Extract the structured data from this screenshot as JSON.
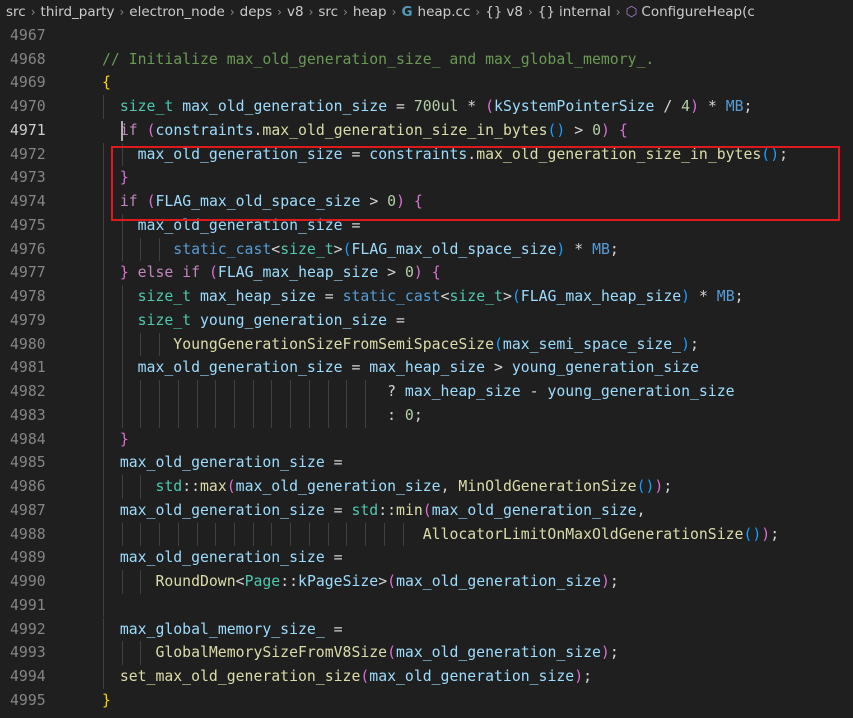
{
  "breadcrumb": [
    {
      "label": "src",
      "kind": "folder"
    },
    {
      "label": "third_party",
      "kind": "folder"
    },
    {
      "label": "electron_node",
      "kind": "folder"
    },
    {
      "label": "deps",
      "kind": "folder"
    },
    {
      "label": "v8",
      "kind": "folder"
    },
    {
      "label": "src",
      "kind": "folder"
    },
    {
      "label": "heap",
      "kind": "folder"
    },
    {
      "label": "heap.cc",
      "kind": "cpp-file-icon"
    },
    {
      "label": "v8",
      "kind": "namespace-icon"
    },
    {
      "label": "internal",
      "kind": "namespace-icon"
    },
    {
      "label": "ConfigureHeap(c",
      "kind": "method-icon"
    }
  ],
  "editor": {
    "active_line": 4971,
    "lines": [
      {
        "n": "4967",
        "guides": [],
        "tokens": []
      },
      {
        "n": "4968",
        "guides": [],
        "tokens": [
          [
            "cm",
            "// Initialize max_old_generation_size_ and max_global_memory_."
          ]
        ]
      },
      {
        "n": "4969",
        "guides": [],
        "tokens": [
          [
            "br1",
            "{"
          ]
        ]
      },
      {
        "n": "4970",
        "guides": [
          1
        ],
        "tokens": [
          [
            "pl",
            "  "
          ],
          [
            "type",
            "size_t"
          ],
          [
            "pl",
            " "
          ],
          [
            "var",
            "max_old_generation_size"
          ],
          [
            "pl",
            " = "
          ],
          [
            "num",
            "700ul"
          ],
          [
            "pl",
            " * "
          ],
          [
            "br2",
            "("
          ],
          [
            "var",
            "kSystemPointerSize"
          ],
          [
            "pl",
            " / "
          ],
          [
            "num",
            "4"
          ],
          [
            "br2",
            ")"
          ],
          [
            "pl",
            " * "
          ],
          [
            "mac",
            "MB"
          ],
          [
            "pl",
            ";"
          ]
        ]
      },
      {
        "n": "4971",
        "guides": [],
        "tokens": [
          [
            "pl",
            "  "
          ],
          [
            "ctl",
            "if"
          ],
          [
            "pl",
            " "
          ],
          [
            "br2",
            "("
          ],
          [
            "var",
            "constraints"
          ],
          [
            "pl",
            "."
          ],
          [
            "fn",
            "max_old_generation_size_in_bytes"
          ],
          [
            "br3",
            "()"
          ],
          [
            "pl",
            " > "
          ],
          [
            "num",
            "0"
          ],
          [
            "br2",
            ")"
          ],
          [
            "pl",
            " "
          ],
          [
            "br2",
            "{"
          ]
        ]
      },
      {
        "n": "4972",
        "guides": [
          1,
          2
        ],
        "tokens": [
          [
            "pl",
            "    "
          ],
          [
            "var",
            "max_old_generation_size"
          ],
          [
            "pl",
            " = "
          ],
          [
            "var",
            "constraints"
          ],
          [
            "pl",
            "."
          ],
          [
            "fn",
            "max_old_generation_size_in_bytes"
          ],
          [
            "br3",
            "()"
          ],
          [
            "pl",
            ";"
          ]
        ]
      },
      {
        "n": "4973",
        "guides": [
          1
        ],
        "tokens": [
          [
            "pl",
            "  "
          ],
          [
            "br2",
            "}"
          ]
        ]
      },
      {
        "n": "4974",
        "guides": [
          1
        ],
        "tokens": [
          [
            "pl",
            "  "
          ],
          [
            "ctl",
            "if"
          ],
          [
            "pl",
            " "
          ],
          [
            "br2",
            "("
          ],
          [
            "var",
            "FLAG_max_old_space_size"
          ],
          [
            "pl",
            " > "
          ],
          [
            "num",
            "0"
          ],
          [
            "br2",
            ")"
          ],
          [
            "pl",
            " "
          ],
          [
            "br2",
            "{"
          ]
        ]
      },
      {
        "n": "4975",
        "guides": [
          1,
          2
        ],
        "tokens": [
          [
            "pl",
            "    "
          ],
          [
            "var",
            "max_old_generation_size"
          ],
          [
            "pl",
            " ="
          ]
        ]
      },
      {
        "n": "4976",
        "guides": [
          1,
          2,
          3,
          4
        ],
        "tokens": [
          [
            "pl",
            "        "
          ],
          [
            "kw",
            "static_cast"
          ],
          [
            "pl",
            "<"
          ],
          [
            "type",
            "size_t"
          ],
          [
            "pl",
            ">"
          ],
          [
            "br3",
            "("
          ],
          [
            "var",
            "FLAG_max_old_space_size"
          ],
          [
            "br3",
            ")"
          ],
          [
            "pl",
            " * "
          ],
          [
            "mac",
            "MB"
          ],
          [
            "pl",
            ";"
          ]
        ]
      },
      {
        "n": "4977",
        "guides": [
          1
        ],
        "tokens": [
          [
            "pl",
            "  "
          ],
          [
            "br2",
            "}"
          ],
          [
            "pl",
            " "
          ],
          [
            "ctl",
            "else"
          ],
          [
            "pl",
            " "
          ],
          [
            "ctl",
            "if"
          ],
          [
            "pl",
            " "
          ],
          [
            "br2",
            "("
          ],
          [
            "var",
            "FLAG_max_heap_size"
          ],
          [
            "pl",
            " > "
          ],
          [
            "num",
            "0"
          ],
          [
            "br2",
            ")"
          ],
          [
            "pl",
            " "
          ],
          [
            "br2",
            "{"
          ]
        ]
      },
      {
        "n": "4978",
        "guides": [
          1,
          2
        ],
        "tokens": [
          [
            "pl",
            "    "
          ],
          [
            "type",
            "size_t"
          ],
          [
            "pl",
            " "
          ],
          [
            "var",
            "max_heap_size"
          ],
          [
            "pl",
            " = "
          ],
          [
            "kw",
            "static_cast"
          ],
          [
            "pl",
            "<"
          ],
          [
            "type",
            "size_t"
          ],
          [
            "pl",
            ">"
          ],
          [
            "br3",
            "("
          ],
          [
            "var",
            "FLAG_max_heap_size"
          ],
          [
            "br3",
            ")"
          ],
          [
            "pl",
            " * "
          ],
          [
            "mac",
            "MB"
          ],
          [
            "pl",
            ";"
          ]
        ]
      },
      {
        "n": "4979",
        "guides": [
          1,
          2
        ],
        "tokens": [
          [
            "pl",
            "    "
          ],
          [
            "type",
            "size_t"
          ],
          [
            "pl",
            " "
          ],
          [
            "var",
            "young_generation_size"
          ],
          [
            "pl",
            " ="
          ]
        ]
      },
      {
        "n": "4980",
        "guides": [
          1,
          2,
          3,
          4
        ],
        "tokens": [
          [
            "pl",
            "        "
          ],
          [
            "fn",
            "YoungGenerationSizeFromSemiSpaceSize"
          ],
          [
            "br3",
            "("
          ],
          [
            "var",
            "max_semi_space_size_"
          ],
          [
            "br3",
            ")"
          ],
          [
            "pl",
            ";"
          ]
        ]
      },
      {
        "n": "4981",
        "guides": [
          1,
          2
        ],
        "tokens": [
          [
            "pl",
            "    "
          ],
          [
            "var",
            "max_old_generation_size"
          ],
          [
            "pl",
            " = "
          ],
          [
            "var",
            "max_heap_size"
          ],
          [
            "pl",
            " > "
          ],
          [
            "var",
            "young_generation_size"
          ]
        ]
      },
      {
        "n": "4982",
        "guides": [
          1,
          2,
          3,
          4,
          5,
          6,
          7,
          8,
          9,
          10,
          11,
          12,
          13,
          14,
          15
        ],
        "tokens": [
          [
            "pl",
            "                                "
          ],
          [
            "pl",
            "? "
          ],
          [
            "var",
            "max_heap_size"
          ],
          [
            "pl",
            " - "
          ],
          [
            "var",
            "young_generation_size"
          ]
        ]
      },
      {
        "n": "4983",
        "guides": [
          1,
          2,
          3,
          4,
          5,
          6,
          7,
          8,
          9,
          10,
          11,
          12,
          13,
          14,
          15
        ],
        "tokens": [
          [
            "pl",
            "                                "
          ],
          [
            "pl",
            ": "
          ],
          [
            "num",
            "0"
          ],
          [
            "pl",
            ";"
          ]
        ]
      },
      {
        "n": "4984",
        "guides": [
          1
        ],
        "tokens": [
          [
            "pl",
            "  "
          ],
          [
            "br2",
            "}"
          ]
        ]
      },
      {
        "n": "4985",
        "guides": [
          1
        ],
        "tokens": [
          [
            "pl",
            "  "
          ],
          [
            "var",
            "max_old_generation_size"
          ],
          [
            "pl",
            " ="
          ]
        ]
      },
      {
        "n": "4986",
        "guides": [
          1,
          2,
          3
        ],
        "tokens": [
          [
            "pl",
            "      "
          ],
          [
            "type",
            "std"
          ],
          [
            "pl",
            "::"
          ],
          [
            "fn",
            "max"
          ],
          [
            "br2",
            "("
          ],
          [
            "var",
            "max_old_generation_size"
          ],
          [
            "pl",
            ", "
          ],
          [
            "fn",
            "MinOldGenerationSize"
          ],
          [
            "br3",
            "()"
          ],
          [
            "br2",
            ")"
          ],
          [
            "pl",
            ";"
          ]
        ]
      },
      {
        "n": "4987",
        "guides": [
          1
        ],
        "tokens": [
          [
            "pl",
            "  "
          ],
          [
            "var",
            "max_old_generation_size"
          ],
          [
            "pl",
            " = "
          ],
          [
            "type",
            "std"
          ],
          [
            "pl",
            "::"
          ],
          [
            "fn",
            "min"
          ],
          [
            "br2",
            "("
          ],
          [
            "var",
            "max_old_generation_size"
          ],
          [
            "pl",
            ","
          ]
        ]
      },
      {
        "n": "4988",
        "guides": [
          1,
          2,
          3,
          4,
          5,
          6,
          7,
          8,
          9,
          10,
          11,
          12,
          13,
          14,
          15,
          16,
          17
        ],
        "tokens": [
          [
            "pl",
            "                                    "
          ],
          [
            "fn",
            "AllocatorLimitOnMaxOldGenerationSize"
          ],
          [
            "br3",
            "()"
          ],
          [
            "br2",
            ")"
          ],
          [
            "pl",
            ";"
          ]
        ]
      },
      {
        "n": "4989",
        "guides": [
          1
        ],
        "tokens": [
          [
            "pl",
            "  "
          ],
          [
            "var",
            "max_old_generation_size"
          ],
          [
            "pl",
            " ="
          ]
        ]
      },
      {
        "n": "4990",
        "guides": [
          1,
          2,
          3
        ],
        "tokens": [
          [
            "pl",
            "      "
          ],
          [
            "fn",
            "RoundDown"
          ],
          [
            "pl",
            "<"
          ],
          [
            "type",
            "Page"
          ],
          [
            "pl",
            "::"
          ],
          [
            "var",
            "kPageSize"
          ],
          [
            "pl",
            ">"
          ],
          [
            "br2",
            "("
          ],
          [
            "var",
            "max_old_generation_size"
          ],
          [
            "br2",
            ")"
          ],
          [
            "pl",
            ";"
          ]
        ]
      },
      {
        "n": "4991",
        "guides": [
          1
        ],
        "tokens": []
      },
      {
        "n": "4992",
        "guides": [
          1
        ],
        "tokens": [
          [
            "pl",
            "  "
          ],
          [
            "var",
            "max_global_memory_size_"
          ],
          [
            "pl",
            " ="
          ]
        ]
      },
      {
        "n": "4993",
        "guides": [
          1,
          2,
          3
        ],
        "tokens": [
          [
            "pl",
            "      "
          ],
          [
            "fn",
            "GlobalMemorySizeFromV8Size"
          ],
          [
            "br2",
            "("
          ],
          [
            "var",
            "max_old_generation_size"
          ],
          [
            "br2",
            ")"
          ],
          [
            "pl",
            ";"
          ]
        ]
      },
      {
        "n": "4994",
        "guides": [
          1
        ],
        "tokens": [
          [
            "pl",
            "  "
          ],
          [
            "fn",
            "set_max_old_generation_size"
          ],
          [
            "br2",
            "("
          ],
          [
            "var",
            "max_old_generation_size"
          ],
          [
            "br2",
            ")"
          ],
          [
            "pl",
            ";"
          ]
        ]
      },
      {
        "n": "4995",
        "guides": [],
        "tokens": [
          [
            "br1",
            "}"
          ]
        ]
      }
    ]
  },
  "colors": {
    "background": "#1f1f1f",
    "highlight_box": "#e0191c",
    "keyword": "#569cd6",
    "type": "#4ec9b0",
    "variable": "#9cdcfe",
    "function": "#dcdcaa",
    "number": "#b5cea8",
    "comment": "#6a9955",
    "control": "#c586c0"
  }
}
